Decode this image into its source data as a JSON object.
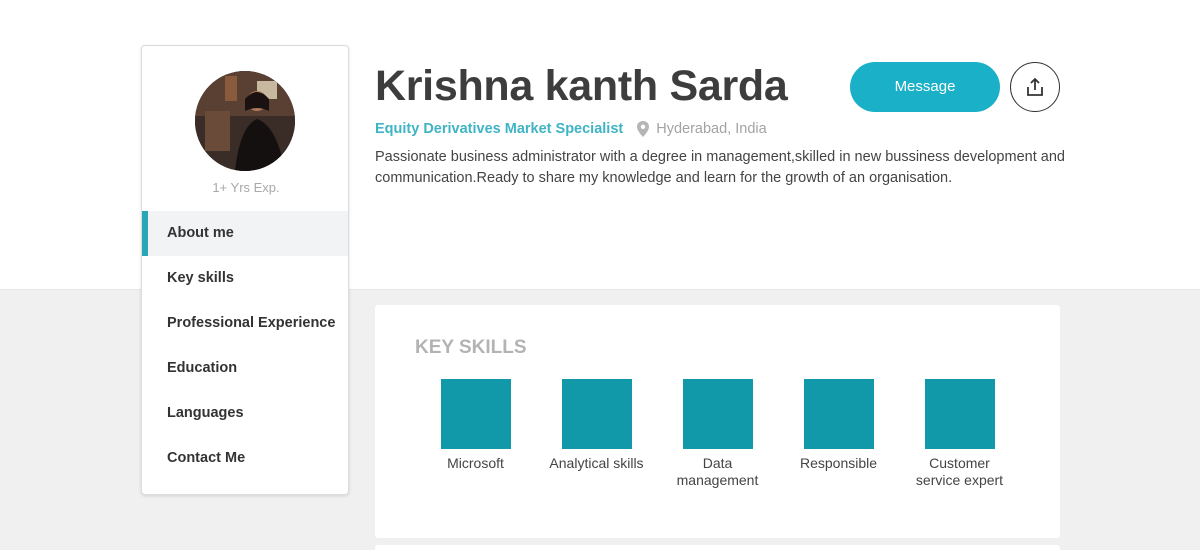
{
  "profile": {
    "name": "Krishna kanth Sarda",
    "title": "Equity Derivatives Market Specialist",
    "location": "Hyderabad, India",
    "bio": "Passionate business administrator with a degree in management,skilled in new bussiness development and communication.Ready to share my knowledge and learn for the growth of an organisation.",
    "experience": "1+ Yrs Exp."
  },
  "actions": {
    "message_label": "Message",
    "share_icon": "share-icon"
  },
  "sidebar": {
    "items": [
      {
        "label": "About me",
        "active": true
      },
      {
        "label": "Key skills",
        "active": false
      },
      {
        "label": "Professional Experience",
        "active": false
      },
      {
        "label": "Education",
        "active": false
      },
      {
        "label": "Languages",
        "active": false
      },
      {
        "label": "Contact Me",
        "active": false
      }
    ]
  },
  "key_skills": {
    "heading": "KEY SKILLS",
    "items": [
      "Microsoft",
      "Analytical skills",
      "Data management",
      "Responsible",
      "Customer service expert"
    ]
  },
  "colors": {
    "accent": "#1ab0c8",
    "title_text": "#3fb4c4",
    "skill_tile": "#1199aa"
  }
}
